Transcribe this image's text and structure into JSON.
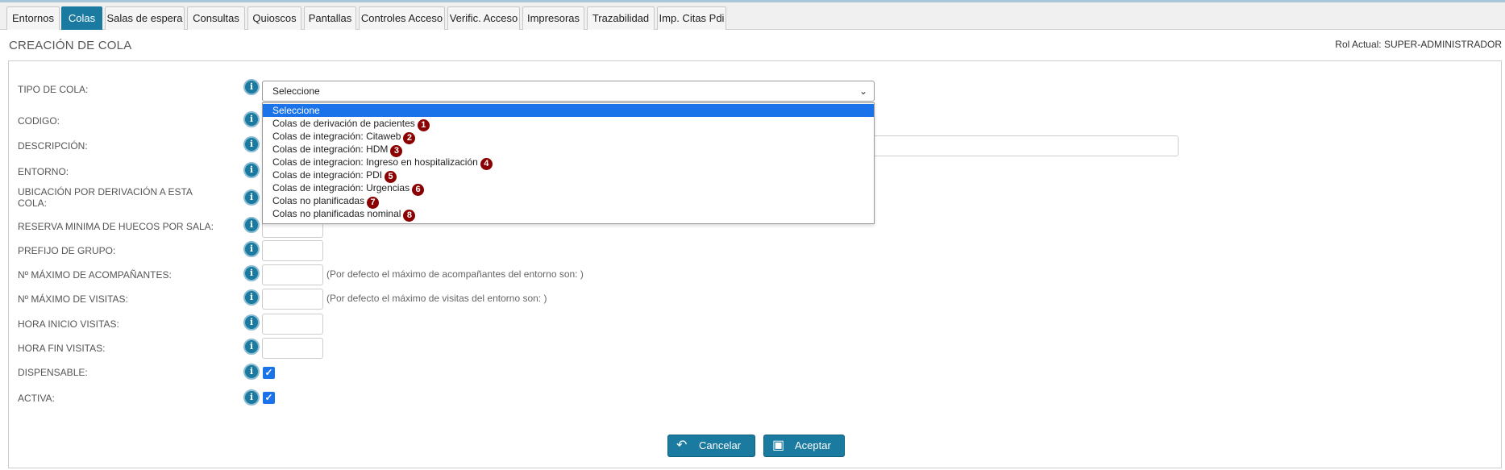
{
  "tabs": [
    {
      "label": "Entornos",
      "active": false
    },
    {
      "label": "Colas",
      "active": true
    },
    {
      "label": "Salas de espera",
      "active": false
    },
    {
      "label": "Consultas",
      "active": false
    },
    {
      "label": "Quioscos",
      "active": false
    },
    {
      "label": "Pantallas",
      "active": false
    },
    {
      "label": "Controles Acceso",
      "active": false
    },
    {
      "label": "Verific. Acceso",
      "active": false
    },
    {
      "label": "Impresoras",
      "active": false
    },
    {
      "label": "Trazabilidad",
      "active": false
    },
    {
      "label": "Imp. Citas Pdi",
      "active": false
    }
  ],
  "header": {
    "title": "CREACIÓN DE COLA",
    "role": "Rol Actual: SUPER-ADMINISTRADOR"
  },
  "form": {
    "tipo_label": "TIPO DE COLA:",
    "codigo_label": "CODIGO:",
    "descripcion_label": "DESCRIPCIÓN:",
    "entorno_label": "ENTORNO:",
    "ubicacion_label_1": "UBICACIÓN POR DERIVACIÓN A ESTA",
    "ubicacion_label_2": "COLA:",
    "reserva_label": "RESERVA MINIMA DE HUECOS POR SALA:",
    "prefijo_label": "PREFIJO DE GRUPO:",
    "max_acomp_label": "Nº MÁXIMO DE ACOMPAÑANTES:",
    "max_acomp_hint": "(Por defecto el máximo de acompañantes del entorno son: )",
    "max_visitas_label": "Nº MÁXIMO DE VISITAS:",
    "max_visitas_hint": "(Por defecto el máximo de visitas del entorno son: )",
    "hora_inicio_label": "HORA INICIO VISITAS:",
    "hora_fin_label": "HORA FIN VISITAS:",
    "dispensable_label": "DISPENSABLE:",
    "dispensable_checked": true,
    "activa_label": "ACTIVA:",
    "activa_checked": true
  },
  "select": {
    "value": "Seleccione",
    "options": [
      {
        "label": "Seleccione",
        "badge": ""
      },
      {
        "label": "Colas de derivación de pacientes",
        "badge": "1"
      },
      {
        "label": "Colas de integración: Citaweb",
        "badge": "2"
      },
      {
        "label": "Colas de integración: HDM",
        "badge": "3"
      },
      {
        "label": "Colas de integracion: Ingreso en hospitalización",
        "badge": "4"
      },
      {
        "label": "Colas de integración: PDI",
        "badge": "5"
      },
      {
        "label": "Colas de integración: Urgencias",
        "badge": "6"
      },
      {
        "label": "Colas no planificadas",
        "badge": "7"
      },
      {
        "label": "Colas no planificadas nominal",
        "badge": "8"
      }
    ]
  },
  "buttons": {
    "cancel": "Cancelar",
    "accept": "Aceptar"
  },
  "colors": {
    "accent": "#1a7aa0",
    "selected": "#1a73e8",
    "badge": "#8b0000"
  }
}
